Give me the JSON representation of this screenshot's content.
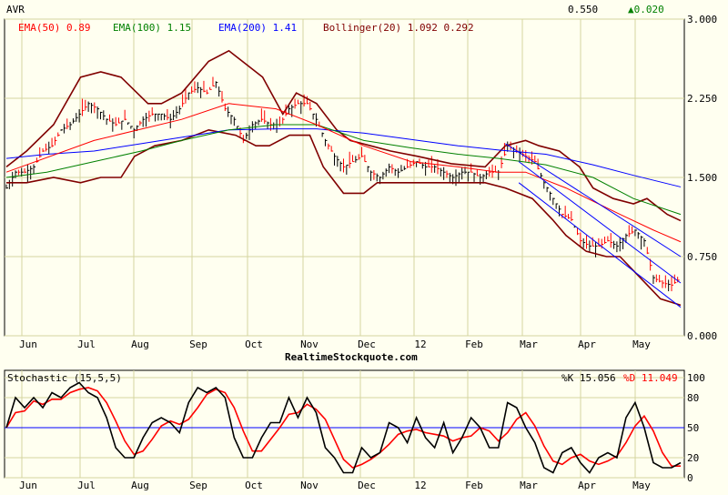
{
  "header": {
    "symbol": "AVR",
    "last": "0.550",
    "change": "▲0.020"
  },
  "watermark": "RealtimeStockquote.com",
  "legend": [
    {
      "text": "EMA(50) 0.89",
      "color": "#ff0000"
    },
    {
      "text": "EMA(100) 1.15",
      "color": "#008000"
    },
    {
      "text": "EMA(200) 1.41",
      "color": "#0000ff"
    },
    {
      "text": "Bollinger(20) 1.092 0.292",
      "color": "#800000"
    }
  ],
  "chart_data": [
    {
      "type": "ohlc",
      "title": "AVR",
      "ylim": [
        0,
        3
      ],
      "yticks": [
        "0.000",
        "0.750",
        "1.500",
        "2.250",
        "3.000"
      ],
      "ytick_values": [
        0,
        0.75,
        1.5,
        2.25,
        3
      ],
      "xticks": [
        "Jun",
        "Jul",
        "Aug",
        "Sep",
        "Oct",
        "Nov",
        "Dec",
        "12",
        "Feb",
        "Mar",
        "Apr",
        "May"
      ],
      "close": [
        1.4,
        1.55,
        1.55,
        1.6,
        1.75,
        1.8,
        1.95,
        2.0,
        2.1,
        2.2,
        2.15,
        2.05,
        2.0,
        2.05,
        1.95,
        2.05,
        2.1,
        2.1,
        2.05,
        2.15,
        2.3,
        2.35,
        2.3,
        2.4,
        2.15,
        2.05,
        1.85,
        2.0,
        2.05,
        2.0,
        2.0,
        2.15,
        2.2,
        2.2,
        2.05,
        1.85,
        1.7,
        1.6,
        1.65,
        1.7,
        1.55,
        1.5,
        1.6,
        1.55,
        1.6,
        1.65,
        1.6,
        1.6,
        1.55,
        1.5,
        1.55,
        1.55,
        1.5,
        1.55,
        1.55,
        1.8,
        1.75,
        1.7,
        1.65,
        1.45,
        1.3,
        1.15,
        1.1,
        0.9,
        0.85,
        0.85,
        0.9,
        0.85,
        0.95,
        1.0,
        0.9,
        0.55,
        0.5,
        0.48,
        0.55
      ],
      "ema50": [
        [
          0,
          1.55
        ],
        [
          0.13,
          1.85
        ],
        [
          0.26,
          2.05
        ],
        [
          0.33,
          2.2
        ],
        [
          0.4,
          2.15
        ],
        [
          0.46,
          2.0
        ],
        [
          0.53,
          1.8
        ],
        [
          0.6,
          1.65
        ],
        [
          0.67,
          1.6
        ],
        [
          0.73,
          1.55
        ],
        [
          0.77,
          1.55
        ],
        [
          0.83,
          1.4
        ],
        [
          0.91,
          1.15
        ],
        [
          0.96,
          1.0
        ],
        [
          1,
          0.89
        ]
      ],
      "ema100": [
        [
          0,
          1.5
        ],
        [
          0.06,
          1.55
        ],
        [
          0.13,
          1.65
        ],
        [
          0.2,
          1.75
        ],
        [
          0.26,
          1.85
        ],
        [
          0.33,
          1.95
        ],
        [
          0.4,
          2.0
        ],
        [
          0.46,
          2.0
        ],
        [
          0.53,
          1.85
        ],
        [
          0.6,
          1.78
        ],
        [
          0.67,
          1.72
        ],
        [
          0.73,
          1.68
        ],
        [
          0.8,
          1.62
        ],
        [
          0.87,
          1.5
        ],
        [
          0.93,
          1.3
        ],
        [
          1,
          1.15
        ]
      ],
      "ema200": [
        [
          0,
          1.68
        ],
        [
          0.06,
          1.72
        ],
        [
          0.13,
          1.75
        ],
        [
          0.2,
          1.82
        ],
        [
          0.26,
          1.88
        ],
        [
          0.33,
          1.95
        ],
        [
          0.4,
          1.96
        ],
        [
          0.46,
          1.96
        ],
        [
          0.53,
          1.92
        ],
        [
          0.6,
          1.86
        ],
        [
          0.67,
          1.8
        ],
        [
          0.73,
          1.76
        ],
        [
          0.8,
          1.72
        ],
        [
          0.87,
          1.62
        ],
        [
          0.93,
          1.52
        ],
        [
          1,
          1.41
        ]
      ],
      "boll_upper": [
        [
          0,
          1.6
        ],
        [
          0.03,
          1.75
        ],
        [
          0.07,
          2.0
        ],
        [
          0.11,
          2.45
        ],
        [
          0.14,
          2.5
        ],
        [
          0.17,
          2.45
        ],
        [
          0.21,
          2.2
        ],
        [
          0.23,
          2.2
        ],
        [
          0.26,
          2.3
        ],
        [
          0.3,
          2.6
        ],
        [
          0.33,
          2.7
        ],
        [
          0.35,
          2.6
        ],
        [
          0.38,
          2.45
        ],
        [
          0.41,
          2.1
        ],
        [
          0.43,
          2.3
        ],
        [
          0.46,
          2.2
        ],
        [
          0.49,
          1.95
        ],
        [
          0.51,
          1.85
        ],
        [
          0.54,
          1.8
        ],
        [
          0.57,
          1.75
        ],
        [
          0.61,
          1.7
        ],
        [
          0.66,
          1.63
        ],
        [
          0.71,
          1.6
        ],
        [
          0.74,
          1.8
        ],
        [
          0.77,
          1.85
        ],
        [
          0.79,
          1.8
        ],
        [
          0.82,
          1.75
        ],
        [
          0.85,
          1.6
        ],
        [
          0.87,
          1.4
        ],
        [
          0.9,
          1.3
        ],
        [
          0.93,
          1.25
        ],
        [
          0.95,
          1.3
        ],
        [
          0.98,
          1.15
        ],
        [
          1,
          1.09
        ]
      ],
      "boll_lower": [
        [
          0,
          1.45
        ],
        [
          0.03,
          1.45
        ],
        [
          0.07,
          1.5
        ],
        [
          0.11,
          1.45
        ],
        [
          0.14,
          1.5
        ],
        [
          0.17,
          1.5
        ],
        [
          0.19,
          1.7
        ],
        [
          0.22,
          1.8
        ],
        [
          0.26,
          1.85
        ],
        [
          0.3,
          1.95
        ],
        [
          0.34,
          1.9
        ],
        [
          0.37,
          1.8
        ],
        [
          0.39,
          1.8
        ],
        [
          0.42,
          1.9
        ],
        [
          0.45,
          1.9
        ],
        [
          0.47,
          1.6
        ],
        [
          0.5,
          1.35
        ],
        [
          0.53,
          1.35
        ],
        [
          0.55,
          1.45
        ],
        [
          0.59,
          1.45
        ],
        [
          0.66,
          1.45
        ],
        [
          0.71,
          1.45
        ],
        [
          0.74,
          1.4
        ],
        [
          0.78,
          1.3
        ],
        [
          0.81,
          1.1
        ],
        [
          0.83,
          0.95
        ],
        [
          0.86,
          0.8
        ],
        [
          0.89,
          0.75
        ],
        [
          0.91,
          0.75
        ],
        [
          0.94,
          0.55
        ],
        [
          0.97,
          0.35
        ],
        [
          1,
          0.29
        ]
      ],
      "channel": [
        [
          [
            0.74,
            1.82
          ],
          [
            1,
            0.75
          ]
        ],
        [
          [
            0.76,
            1.65
          ],
          [
            1,
            0.5
          ]
        ],
        [
          [
            0.76,
            1.45
          ],
          [
            1,
            0.27
          ]
        ]
      ]
    },
    {
      "type": "line",
      "title": "Stochastic (15,5,5)",
      "ylim": [
        0,
        100
      ],
      "yticks": [
        "0",
        "20",
        "50",
        "80",
        "100"
      ],
      "ytick_values": [
        0,
        20,
        50,
        80,
        100
      ],
      "k_label": "%K 15.056",
      "d_label": "%D 11.049",
      "k": [
        50,
        80,
        70,
        80,
        70,
        85,
        80,
        90,
        95,
        85,
        80,
        60,
        30,
        20,
        20,
        40,
        55,
        60,
        55,
        45,
        75,
        90,
        85,
        90,
        80,
        40,
        20,
        20,
        40,
        55,
        55,
        80,
        60,
        80,
        65,
        30,
        20,
        5,
        5,
        30,
        20,
        25,
        55,
        50,
        35,
        60,
        40,
        30,
        55,
        25,
        40,
        60,
        50,
        30,
        30,
        75,
        70,
        50,
        35,
        10,
        5,
        25,
        30,
        15,
        5,
        20,
        25,
        20,
        60,
        75,
        50,
        15,
        10,
        10,
        15
      ]
    }
  ]
}
